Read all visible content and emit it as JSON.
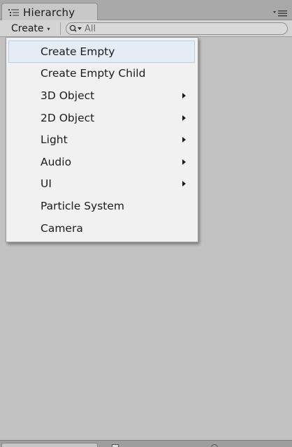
{
  "window": {
    "tab_title": "Hierarchy",
    "tab_icon": "hierarchy-list-icon",
    "panel_menu_icon": "panel-options-icon"
  },
  "toolbar": {
    "create_label": "Create",
    "create_arrow": "▾",
    "search_placeholder": "All",
    "search_icon": "search-icon"
  },
  "menu": {
    "items": [
      {
        "label": "Create Empty",
        "submenu": false,
        "highlighted": true
      },
      {
        "label": "Create Empty Child",
        "submenu": false
      },
      {
        "label": "3D Object",
        "submenu": true
      },
      {
        "label": "2D Object",
        "submenu": true
      },
      {
        "label": "Light",
        "submenu": true
      },
      {
        "label": "Audio",
        "submenu": true
      },
      {
        "label": "UI",
        "submenu": true
      },
      {
        "label": "Particle System",
        "submenu": false
      },
      {
        "label": "Camera",
        "submenu": false
      }
    ]
  },
  "colors": {
    "panel_background": "#c2c2c2",
    "menu_background": "#f1f1f1",
    "highlight": "#e4ecf6",
    "text": "#1b1b1b"
  }
}
